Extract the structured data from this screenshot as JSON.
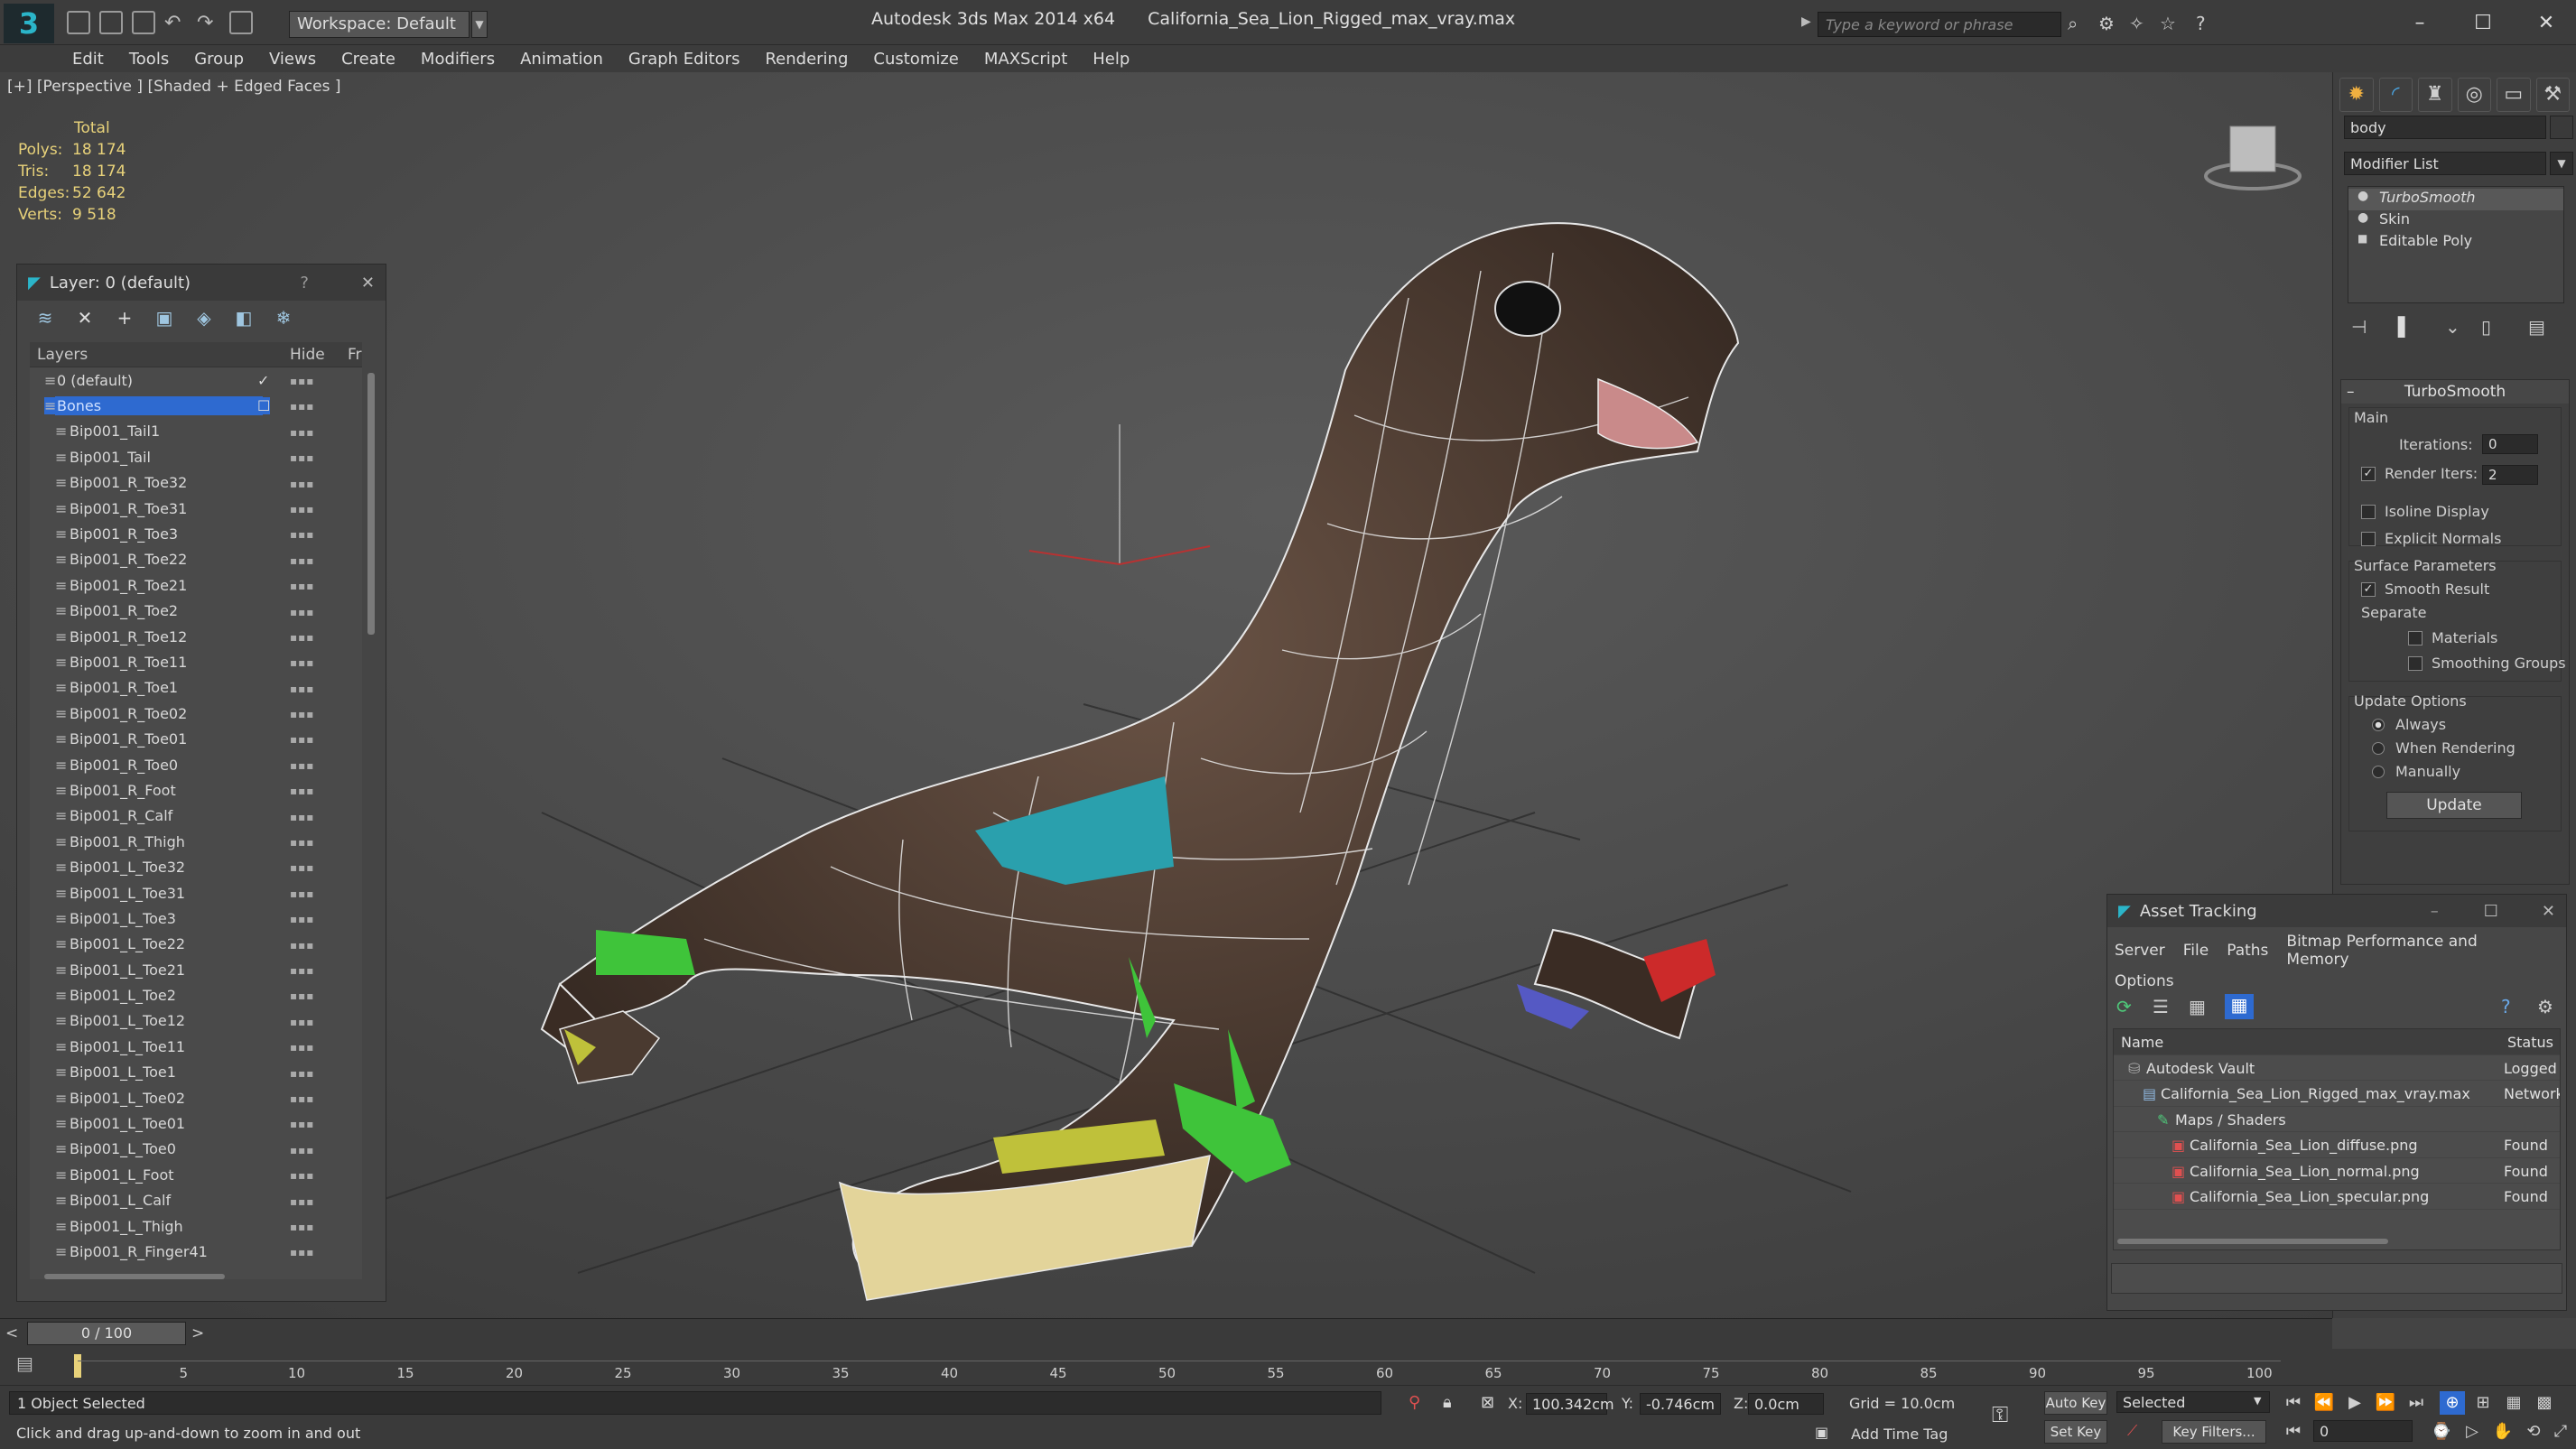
{
  "titlebar": {
    "workspace_label": "Workspace: Default",
    "app_name": "Autodesk 3ds Max  2014 x64",
    "file_name": "California_Sea_Lion_Rigged_max_vray.max",
    "search_placeholder": "Type a keyword or phrase"
  },
  "menu": [
    "Edit",
    "Tools",
    "Group",
    "Views",
    "Create",
    "Modifiers",
    "Animation",
    "Graph Editors",
    "Rendering",
    "Customize",
    "MAXScript",
    "Help"
  ],
  "viewport": {
    "label": "[+] [Perspective ] [Shaded + Edged Faces ]",
    "stats": {
      "header": "Total",
      "polys_label": "Polys:",
      "polys": "18 174",
      "tris_label": "Tris:",
      "tris": "18 174",
      "edges_label": "Edges:",
      "edges": "52 642",
      "verts_label": "Verts:",
      "verts": "9 518"
    }
  },
  "layer_panel": {
    "title": "Layer: 0 (default)",
    "help": "?",
    "col_layers": "Layers",
    "col_hide": "Hide",
    "col_fr": "Fr",
    "rows": [
      {
        "name": "0 (default)",
        "level": 1,
        "check": "✓"
      },
      {
        "name": "Bones",
        "level": 1,
        "selected": true,
        "check": "☐"
      },
      {
        "name": "Bip001_Tail1",
        "level": 2
      },
      {
        "name": "Bip001_Tail",
        "level": 2
      },
      {
        "name": "Bip001_R_Toe32",
        "level": 2
      },
      {
        "name": "Bip001_R_Toe31",
        "level": 2
      },
      {
        "name": "Bip001_R_Toe3",
        "level": 2
      },
      {
        "name": "Bip001_R_Toe22",
        "level": 2
      },
      {
        "name": "Bip001_R_Toe21",
        "level": 2
      },
      {
        "name": "Bip001_R_Toe2",
        "level": 2
      },
      {
        "name": "Bip001_R_Toe12",
        "level": 2
      },
      {
        "name": "Bip001_R_Toe11",
        "level": 2
      },
      {
        "name": "Bip001_R_Toe1",
        "level": 2
      },
      {
        "name": "Bip001_R_Toe02",
        "level": 2
      },
      {
        "name": "Bip001_R_Toe01",
        "level": 2
      },
      {
        "name": "Bip001_R_Toe0",
        "level": 2
      },
      {
        "name": "Bip001_R_Foot",
        "level": 2
      },
      {
        "name": "Bip001_R_Calf",
        "level": 2
      },
      {
        "name": "Bip001_R_Thigh",
        "level": 2
      },
      {
        "name": "Bip001_L_Toe32",
        "level": 2
      },
      {
        "name": "Bip001_L_Toe31",
        "level": 2
      },
      {
        "name": "Bip001_L_Toe3",
        "level": 2
      },
      {
        "name": "Bip001_L_Toe22",
        "level": 2
      },
      {
        "name": "Bip001_L_Toe21",
        "level": 2
      },
      {
        "name": "Bip001_L_Toe2",
        "level": 2
      },
      {
        "name": "Bip001_L_Toe12",
        "level": 2
      },
      {
        "name": "Bip001_L_Toe11",
        "level": 2
      },
      {
        "name": "Bip001_L_Toe1",
        "level": 2
      },
      {
        "name": "Bip001_L_Toe02",
        "level": 2
      },
      {
        "name": "Bip001_L_Toe01",
        "level": 2
      },
      {
        "name": "Bip001_L_Toe0",
        "level": 2
      },
      {
        "name": "Bip001_L_Foot",
        "level": 2
      },
      {
        "name": "Bip001_L_Calf",
        "level": 2
      },
      {
        "name": "Bip001_L_Thigh",
        "level": 2
      },
      {
        "name": "Bip001_R_Finger41",
        "level": 2
      }
    ]
  },
  "command_panel": {
    "object_name": "body",
    "modifier_list": "Modifier List",
    "stack": [
      "TurboSmooth",
      "Skin",
      "Editable Poly"
    ],
    "rollout_title": "TurboSmooth",
    "main_label": "Main",
    "iterations_label": "Iterations:",
    "iterations_value": "0",
    "render_iters_label": "Render Iters:",
    "render_iters_value": "2",
    "isoline_label": "Isoline Display",
    "explicit_normals_label": "Explicit Normals",
    "surface_params_label": "Surface Parameters",
    "smooth_result_label": "Smooth Result",
    "separate_label": "Separate",
    "materials_label": "Materials",
    "smoothing_groups_label": "Smoothing Groups",
    "update_options_label": "Update Options",
    "always_label": "Always",
    "when_rendering_label": "When Rendering",
    "manually_label": "Manually",
    "update_button": "Update"
  },
  "asset_tracking": {
    "title": "Asset Tracking",
    "menu": [
      "Server",
      "File",
      "Paths",
      "Bitmap Performance and Memory"
    ],
    "menu2": "Options",
    "col_name": "Name",
    "col_status": "Status",
    "rows": [
      {
        "name": "Autodesk Vault",
        "status": "Logged",
        "indent": 1,
        "icon": "vault-icon"
      },
      {
        "name": "California_Sea_Lion_Rigged_max_vray.max",
        "status": "Network",
        "indent": 2,
        "icon": "max-file-icon"
      },
      {
        "name": "Maps / Shaders",
        "status": "",
        "indent": 3,
        "icon": "maps-icon"
      },
      {
        "name": "California_Sea_Lion_diffuse.png",
        "status": "Found",
        "indent": 4,
        "icon": "png-icon"
      },
      {
        "name": "California_Sea_Lion_normal.png",
        "status": "Found",
        "indent": 4,
        "icon": "png-icon"
      },
      {
        "name": "California_Sea_Lion_specular.png",
        "status": "Found",
        "indent": 4,
        "icon": "png-icon"
      }
    ]
  },
  "timeline": {
    "frame": "0 / 100",
    "ticks": [
      "5",
      "10",
      "15",
      "20",
      "25",
      "30",
      "35",
      "40",
      "45",
      "50",
      "55",
      "60",
      "65",
      "70",
      "75",
      "80",
      "85",
      "90",
      "95",
      "100"
    ]
  },
  "status": {
    "selection": "1 Object Selected",
    "prompt": "Click and drag up-and-down to zoom in and out",
    "x_label": "X:",
    "x": "100.342cm",
    "y_label": "Y:",
    "y": "-0.746cm",
    "z_label": "Z:",
    "z": "0.0cm",
    "grid": "Grid = 10.0cm",
    "add_time_tag": "Add Time Tag",
    "auto_key": "Auto Key",
    "set_key": "Set Key",
    "selected_dropdown": "Selected",
    "key_filters": "Key Filters...",
    "frame_field": "0"
  },
  "colors": {
    "accent": "#2e6ad0",
    "stats": "#e8d27a",
    "teal": "#2bb5c9"
  }
}
